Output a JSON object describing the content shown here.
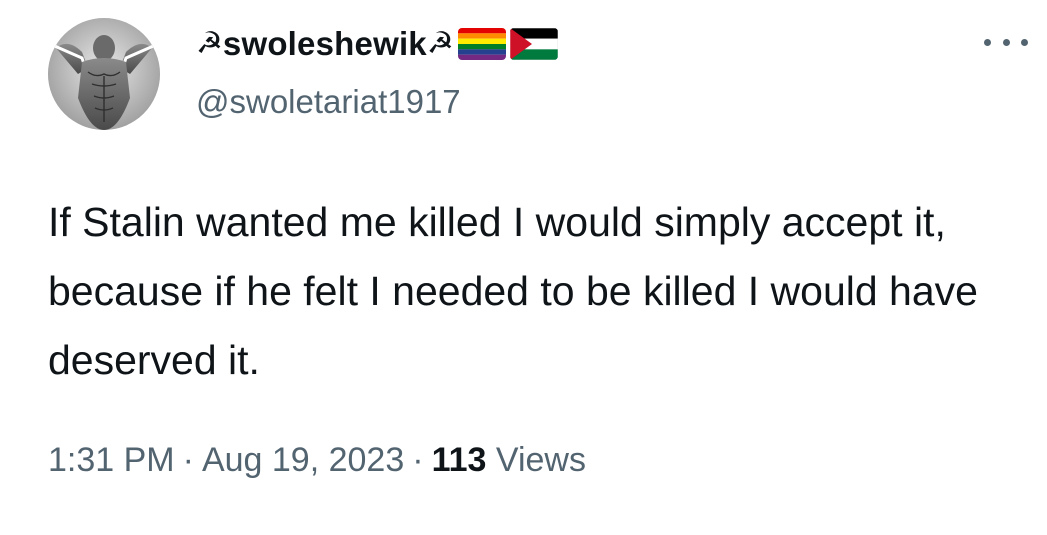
{
  "author": {
    "display_name": "swoleshewik",
    "name_emoji_left": "☭",
    "name_emoji_right": "☭",
    "flag_icons": [
      "rainbow-flag-icon",
      "palestine-flag-icon"
    ],
    "handle": "@swoletariat1917"
  },
  "tweet": {
    "text": "If Stalin wanted me killed I would simply accept it, because if he felt I needed to be killed I would have deserved it."
  },
  "meta": {
    "time": "1:31 PM",
    "separator": "·",
    "date": "Aug 19, 2023",
    "views_count": "113",
    "views_label": "Views"
  },
  "colors": {
    "text_primary": "#0f1419",
    "text_secondary": "#536471",
    "background": "#ffffff"
  }
}
